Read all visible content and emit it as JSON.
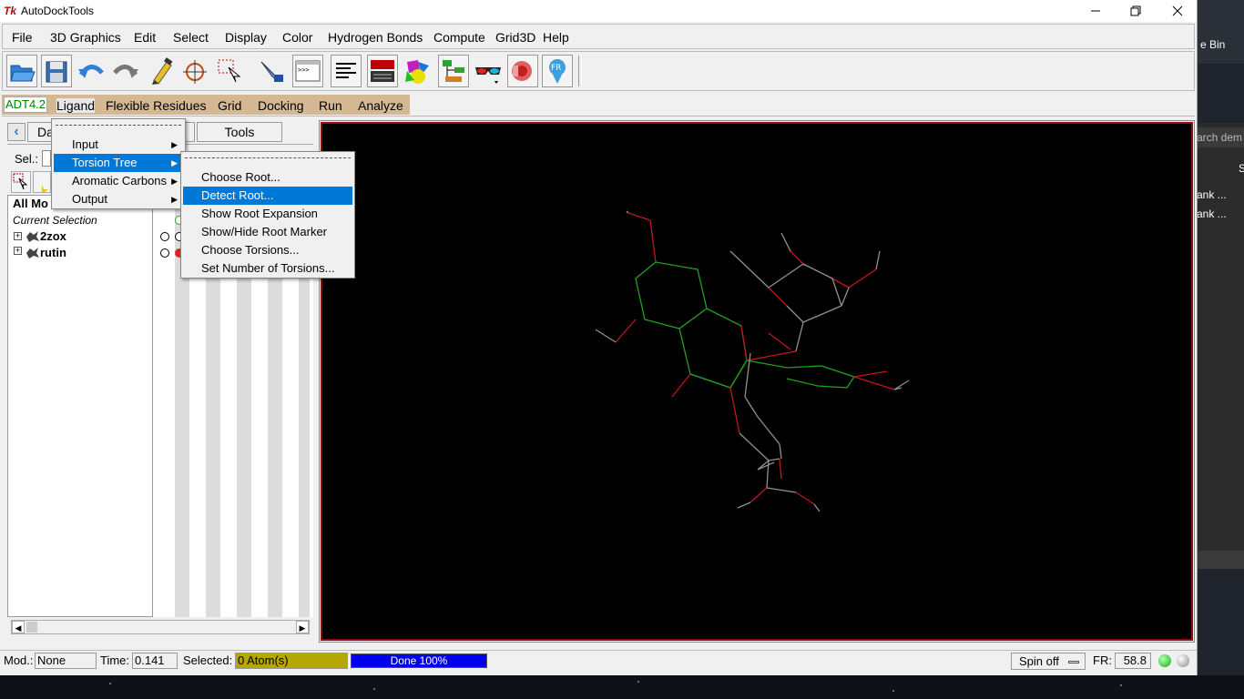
{
  "window": {
    "title": "AutoDockTools",
    "logo": "Tk",
    "icons": {
      "minimize": "minimize-icon",
      "maximize": "maximize-icon",
      "close": "close-icon"
    }
  },
  "menubar": [
    "File",
    "3D Graphics",
    "Edit",
    "Select",
    "Display",
    "Color",
    "Hydrogen Bonds",
    "Compute",
    "Grid3D",
    "Help"
  ],
  "toolbar_icons": [
    "open-file-icon",
    "save-icon",
    "undo-icon",
    "redo-icon",
    "pick-pen-icon",
    "center-target-icon",
    "select-icon",
    "label-icon",
    "python-shell-icon",
    "text-align-icon",
    "display-panel-icon",
    "shapes-icon",
    "dashboard-icon",
    "stereo-glasses-icon",
    "dejavu-icon",
    "fr-icon"
  ],
  "adt": {
    "version": "ADT4.2",
    "items": [
      "Ligand",
      "Flexible Residues",
      "Grid",
      "Docking",
      "Run",
      "Analyze"
    ]
  },
  "left_panel": {
    "tabs": {
      "dashboard_partial": "Da",
      "tools": "Tools"
    },
    "sel_label": "Sel.:",
    "all_molecules_partial": "All Mo",
    "current_selection": "Current Selection",
    "molecules": [
      "2zox",
      "rutin"
    ]
  },
  "ligand_menu": {
    "items": [
      "Input",
      "Torsion Tree",
      "Aromatic Carbons",
      "Output"
    ],
    "highlighted": "Torsion Tree"
  },
  "torsion_menu": {
    "items": [
      "Choose Root...",
      "Detect Root...",
      "Show Root Expansion",
      "Show/Hide Root Marker",
      "Choose Torsions...",
      "Set Number of Torsions..."
    ],
    "highlighted": "Detect Root..."
  },
  "statusbar": {
    "mod_label": "Mod.:",
    "mod_value": "None",
    "time_label": "Time:",
    "time_value": "0.141",
    "selected_label": "Selected:",
    "selected_value": "0 Atom(s)",
    "progress": "Done 100%",
    "spin": "Spin off",
    "fr_label": "FR:",
    "fr_value": "58.8"
  },
  "desktop": {
    "recycle_partial": "e Bin",
    "search_partial": "arch dem",
    "items": [
      "ank ...",
      "ank ..."
    ],
    "letter": "S"
  },
  "colors": {
    "viewer_border": "#8b1010",
    "carbon_green": "#22a022",
    "oxygen_red": "#c01818",
    "bond_gray": "#909090",
    "highlight": "#0078d7",
    "adt_bar": "#d4b894",
    "selected_box": "#b4a800",
    "progress_blue": "#0000ee"
  }
}
